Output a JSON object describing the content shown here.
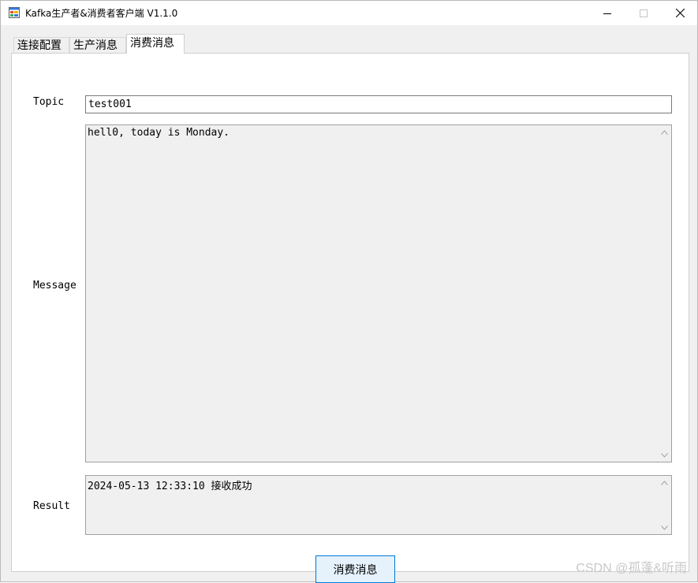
{
  "window": {
    "title": "Kafka生产者&消费者客户端 V1.1.0",
    "icon": "app-window-icon",
    "controls": [
      "minimize-icon",
      "maximize-icon",
      "close-icon"
    ]
  },
  "tabs": [
    {
      "label": "连接配置"
    },
    {
      "label": "生产消息"
    },
    {
      "label": "消费消息"
    }
  ],
  "active_tab": "消费消息",
  "form": {
    "topic_label": "Topic",
    "topic_value": "test001",
    "message_label": "Message",
    "message_text": "hell0, today is Monday.",
    "result_label": "Result",
    "result_text": "2024-05-13 12:33:10 接收成功"
  },
  "actions": {
    "consume_label": "消费消息"
  },
  "watermark": "CSDN @孤蓬&听雨",
  "colors": {
    "accent": "#0078d7",
    "button_bg": "#e5f1fb",
    "window_bg": "#f0f0f0"
  }
}
